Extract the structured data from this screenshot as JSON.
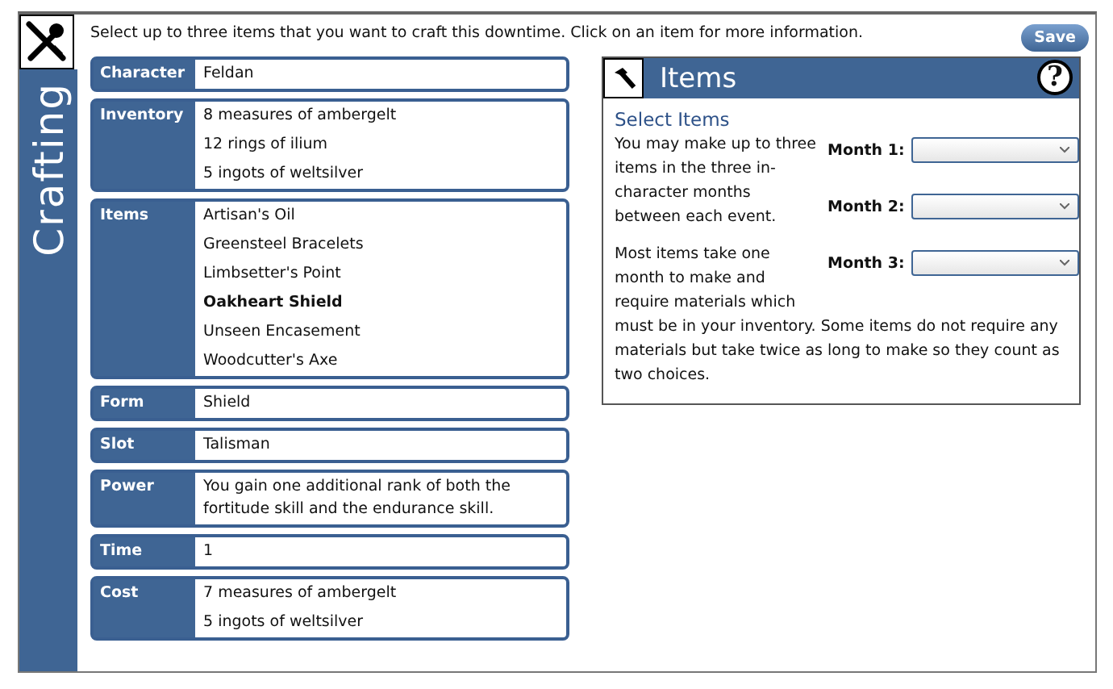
{
  "sidebar": {
    "title": "Crafting"
  },
  "instructions": "Select up to three items that you want to craft this downtime. Click on an item for more information.",
  "save_button": "Save",
  "fields": [
    {
      "label": "Character",
      "lines": [
        "Feldan"
      ]
    },
    {
      "label": "Inventory",
      "lines": [
        "8 measures of ambergelt",
        "12 rings of ilium",
        "5 ingots of weltsilver"
      ]
    },
    {
      "label": "Items",
      "kind": "list",
      "items": [
        {
          "name": "Artisan's Oil",
          "selected": false
        },
        {
          "name": "Greensteel Bracelets",
          "selected": false
        },
        {
          "name": "Limbsetter's Point",
          "selected": false
        },
        {
          "name": "Oakheart Shield",
          "selected": true
        },
        {
          "name": "Unseen Encasement",
          "selected": false
        },
        {
          "name": "Woodcutter's Axe",
          "selected": false
        }
      ]
    },
    {
      "label": "Form",
      "lines": [
        "Shield"
      ]
    },
    {
      "label": "Slot",
      "lines": [
        "Talisman"
      ]
    },
    {
      "label": "Power",
      "lines": [
        "You gain one additional rank of both the fortitude skill and the endurance skill."
      ]
    },
    {
      "label": "Time",
      "lines": [
        "1"
      ]
    },
    {
      "label": "Cost",
      "lines": [
        "7 measures of ambergelt",
        "5 ingots of weltsilver"
      ]
    }
  ],
  "panel": {
    "title": "Items",
    "help": "?",
    "heading": "Select Items",
    "paragraphs": [
      "You may make up to three items in the three in-character months between each event.",
      "Most items take one month to make and require materials which"
    ],
    "continuation": "must be in your inventory. Some items do not require any materials but take twice as long to make so they count as two choices.",
    "months": [
      {
        "label": "Month 1:"
      },
      {
        "label": "Month 2:"
      },
      {
        "label": "Month 3:"
      }
    ]
  }
}
